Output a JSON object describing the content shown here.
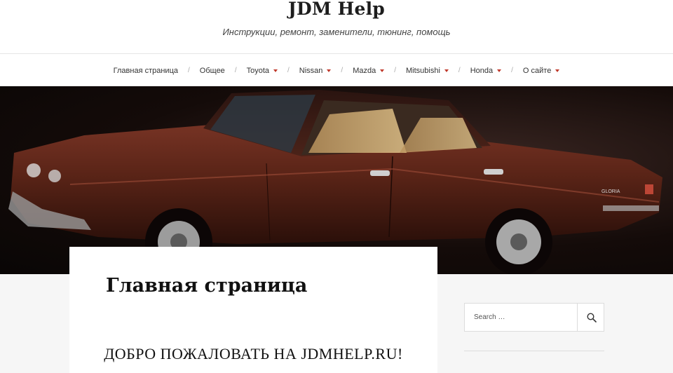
{
  "site": {
    "title": "JDM Help",
    "tagline": "Инструкции, ремонт, заменители, тюнинг, помощь"
  },
  "nav": {
    "items": [
      {
        "label": "Главная страница",
        "has_dropdown": false
      },
      {
        "label": "Общее",
        "has_dropdown": false
      },
      {
        "label": "Toyota",
        "has_dropdown": true
      },
      {
        "label": "Nissan",
        "has_dropdown": true
      },
      {
        "label": "Mazda",
        "has_dropdown": true
      },
      {
        "label": "Mitsubishi",
        "has_dropdown": true
      },
      {
        "label": "Honda",
        "has_dropdown": true
      },
      {
        "label": "О сайте",
        "has_dropdown": true
      }
    ],
    "separator": "/",
    "dropdown_icon": "chevron-down-icon"
  },
  "hero": {
    "badge_text": "GLORIA"
  },
  "main": {
    "page_title": "Главная страница",
    "welcome_heading": "ДОБРО ПОЖАЛОВАТЬ НА JDMHELP.RU!"
  },
  "sidebar": {
    "search": {
      "placeholder": "Search …",
      "value": "",
      "icon": "search-icon"
    }
  },
  "colors": {
    "accent": "#c0392b",
    "background": "#f6f6f6",
    "header_bg": "#ffffff"
  }
}
